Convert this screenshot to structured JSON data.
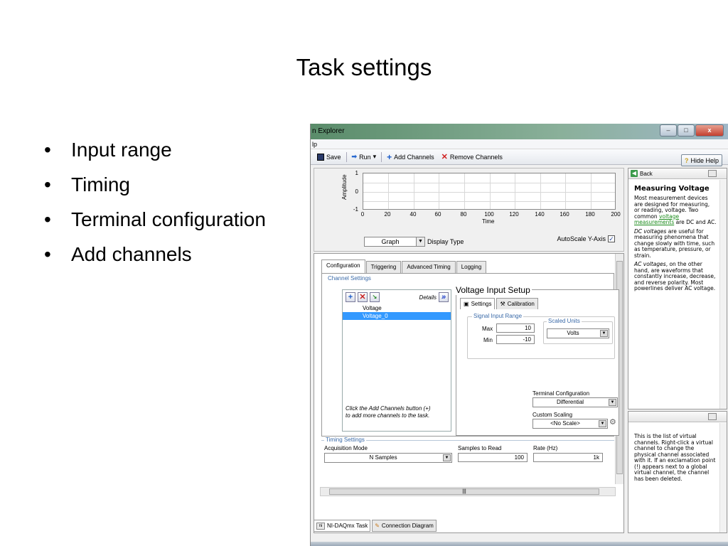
{
  "slide": {
    "title": "Task settings",
    "bullets": [
      "Input range",
      "Timing",
      "Terminal configuration",
      "Add channels"
    ]
  },
  "window": {
    "title": "n Explorer",
    "menu": "lp",
    "buttons": {
      "minimize": "–",
      "maximize": "□",
      "close": "x"
    }
  },
  "toolbar": {
    "save": "Save",
    "run": "Run",
    "run_arrow": "▾",
    "add_channels": "Add Channels",
    "remove_channels": "Remove Channels",
    "hide_help": "Hide Help"
  },
  "graph": {
    "y_axis_label": "Amplitude",
    "x_axis_label": "Time",
    "y_ticks": [
      "1",
      "0",
      "-1"
    ],
    "x_ticks": [
      "0",
      "20",
      "40",
      "60",
      "80",
      "100",
      "120",
      "140",
      "160",
      "180",
      "200"
    ],
    "display_select": "Graph",
    "display_type_label": "Display Type",
    "autoscale_label": "AutoScale Y-Axis",
    "autoscale_checked": true
  },
  "config": {
    "tabs": [
      "Configuration",
      "Triggering",
      "Advanced Timing",
      "Logging"
    ],
    "channel_settings_label": "Channel Settings",
    "details_label": "Details",
    "channels": [
      "Voltage",
      "Voltage_0"
    ],
    "hint": "Click the Add Channels button (+) to add more channels to the task.",
    "voltage_setup_title": "Voltage Input Setup",
    "subtabs": [
      "Settings",
      "Calibration"
    ],
    "signal_input_range": "Signal Input Range",
    "max_label": "Max",
    "max_value": "10",
    "min_label": "Min",
    "min_value": "-10",
    "scaled_units_label": "Scaled Units",
    "scaled_units_value": "Volts",
    "terminal_config_label": "Terminal Configuration",
    "terminal_config_value": "Differential",
    "custom_scaling_label": "Custom Scaling",
    "custom_scaling_value": "<No Scale>",
    "timing_settings_label": "Timing Settings",
    "acq_mode_label": "Acquisition Mode",
    "acq_mode_value": "N Samples",
    "samples_label": "Samples to Read",
    "samples_value": "100",
    "rate_label": "Rate (Hz)",
    "rate_value": "1k"
  },
  "bottom_tabs": [
    "NI-DAQmx Task",
    "Connection Diagram"
  ],
  "help": {
    "back": "Back",
    "title": "Measuring Voltage",
    "p1_pre": "Most measurement devices are designed for measuring, or reading, voltage. Two common ",
    "p1_link": "voltage measurements",
    "p1_post": " are DC and AC.",
    "p2_em": "DC voltages",
    "p2": " are useful for measuring phenomena that change slowly with time, such as temperature, pressure, or strain.",
    "p3_em": "AC voltages",
    "p3": ", on the other hand, are waveforms that constantly increase, decrease, and reverse polarity. Most powerlines deliver AC voltage.",
    "p4": "This is the list of virtual channels. Right-click a virtual channel to change the physical channel associated with it. If an exclamation point (!) appears next to a global virtual channel, the channel has been deleted."
  },
  "colors": {
    "accent": "#3399ff",
    "group_title": "#3a6aa8",
    "link": "#1a8a1a",
    "close_button": "#c44030"
  }
}
